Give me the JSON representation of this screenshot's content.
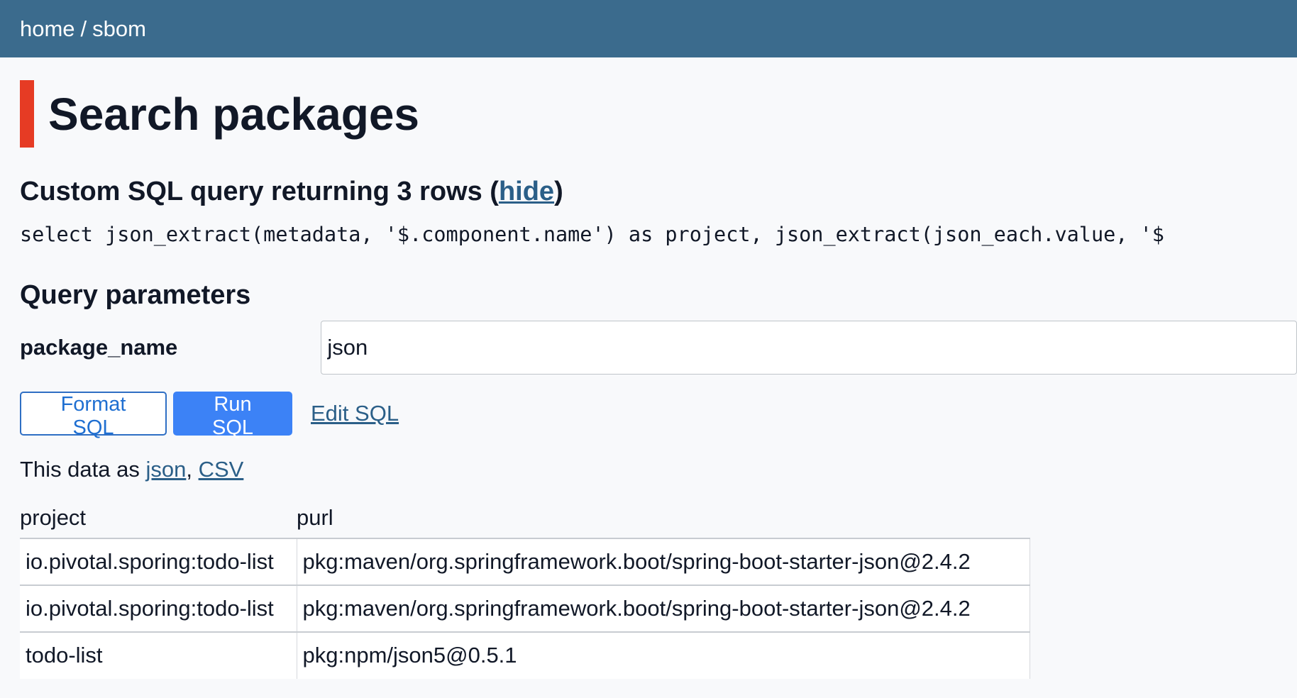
{
  "breadcrumb": {
    "home": "home",
    "separator": "/",
    "current": "sbom"
  },
  "page": {
    "title": "Search packages"
  },
  "sql": {
    "heading_prefix": "Custom SQL query returning 3 rows (",
    "hide_label": "hide",
    "heading_suffix": ")",
    "query": "select json_extract(metadata, '$.component.name') as project, json_extract(json_each.value, '$"
  },
  "params": {
    "heading": "Query parameters",
    "package_name_label": "package_name",
    "package_name_value": "json"
  },
  "actions": {
    "format_label": "Format SQL",
    "run_label": "Run SQL",
    "edit_label": "Edit SQL"
  },
  "export": {
    "prefix": "This data as ",
    "json_label": "json",
    "comma": ", ",
    "csv_label": "CSV"
  },
  "table": {
    "columns": [
      "project",
      "purl"
    ],
    "rows": [
      [
        "io.pivotal.sporing:todo-list",
        "pkg:maven/org.springframework.boot/spring-boot-starter-json@2.4.2"
      ],
      [
        "io.pivotal.sporing:todo-list",
        "pkg:maven/org.springframework.boot/spring-boot-starter-json@2.4.2"
      ],
      [
        "todo-list",
        "pkg:npm/json5@0.5.1"
      ]
    ]
  },
  "colors": {
    "header_bg": "#3b6b8d",
    "accent_bar": "#e63b24",
    "link": "#2b5f88",
    "primary_button": "#3c82f6"
  }
}
